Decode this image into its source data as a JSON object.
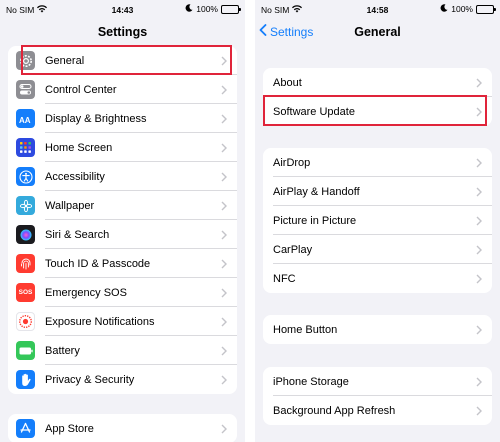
{
  "left": {
    "status": {
      "carrier": "No SIM",
      "time": "14:43",
      "battery": "100%"
    },
    "title": "Settings",
    "items": [
      {
        "label": "General",
        "icon": "gear-icon",
        "color": "#8e8e93"
      },
      {
        "label": "Control Center",
        "icon": "toggles-icon",
        "color": "#8e8e93"
      },
      {
        "label": "Display & Brightness",
        "icon": "text-size-icon",
        "color": "#147efb"
      },
      {
        "label": "Home Screen",
        "icon": "app-grid-icon",
        "color": "#2d4ae0"
      },
      {
        "label": "Accessibility",
        "icon": "accessibility-icon",
        "color": "#147efb"
      },
      {
        "label": "Wallpaper",
        "icon": "flower-icon",
        "color": "#34aadc"
      },
      {
        "label": "Siri & Search",
        "icon": "siri-icon",
        "color": "#1b1b1f"
      },
      {
        "label": "Touch ID & Passcode",
        "icon": "fingerprint-icon",
        "color": "#ff3b30"
      },
      {
        "label": "Emergency SOS",
        "icon": "sos-icon",
        "sos_text": "SOS",
        "color": "#ff3b30"
      },
      {
        "label": "Exposure Notifications",
        "icon": "exposure-icon",
        "color": "#ffffff"
      },
      {
        "label": "Battery",
        "icon": "battery-icon",
        "color": "#34c759"
      },
      {
        "label": "Privacy & Security",
        "icon": "hand-icon",
        "color": "#147efb"
      }
    ],
    "items2": [
      {
        "label": "App Store",
        "icon": "app-store-icon",
        "color": "#147efb"
      }
    ]
  },
  "right": {
    "status": {
      "carrier": "No SIM",
      "time": "14:58",
      "battery": "100%"
    },
    "back_label": "Settings",
    "title": "General",
    "group1": [
      "About",
      "Software Update"
    ],
    "group2": [
      "AirDrop",
      "AirPlay & Handoff",
      "Picture in Picture",
      "CarPlay",
      "NFC"
    ],
    "group3": [
      "Home Button"
    ],
    "group4": [
      "iPhone Storage",
      "Background App Refresh"
    ]
  },
  "colors": {
    "accent": "#147efb",
    "highlight": "#e0243a",
    "background": "#f2f2f7"
  }
}
